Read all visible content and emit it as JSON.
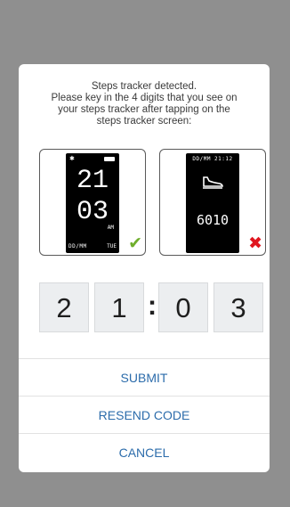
{
  "dialog": {
    "message_lines": [
      "Steps tracker detected.",
      "Please key in the 4 digits that you see on",
      "your steps tracker after tapping on the",
      "steps tracker screen:"
    ],
    "correct_example": {
      "hour": "21",
      "minute": "03",
      "ampm": "AM",
      "date": "DD/MM",
      "day": "TUE",
      "bluetooth_icon": "bluetooth-icon",
      "battery_icon": "battery-icon",
      "check_icon": "check-icon",
      "check_color": "#6fae2c"
    },
    "wrong_example": {
      "top_label": "DD/MM  21:12",
      "steps": "6010",
      "shoe_icon": "shoe-icon",
      "cross_icon": "cross-icon",
      "cross_color": "#e0161f"
    },
    "code_digits": [
      "2",
      "1",
      "0",
      "3"
    ],
    "separator": ":",
    "buttons": {
      "submit": "SUBMIT",
      "resend": "RESEND CODE",
      "cancel": "CANCEL"
    },
    "accent_color": "#2c6cab"
  }
}
